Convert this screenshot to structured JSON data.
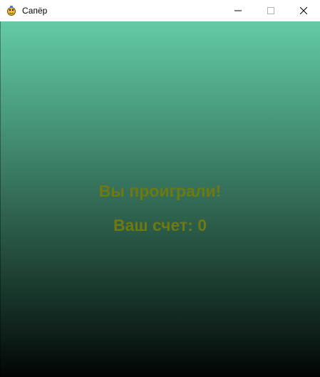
{
  "window": {
    "title": "Сапёр",
    "icon": "pygame-snake-icon",
    "controls": {
      "minimize": "minimize-icon",
      "maximize": "maximize-icon",
      "close": "close-icon"
    }
  },
  "game": {
    "lose_message": "Вы проиграли!",
    "score_text": "Ваш счет: 0",
    "colors": {
      "gradient_top": "#64cba6",
      "gradient_bottom": "#020504",
      "text": "#6e7a10"
    }
  }
}
